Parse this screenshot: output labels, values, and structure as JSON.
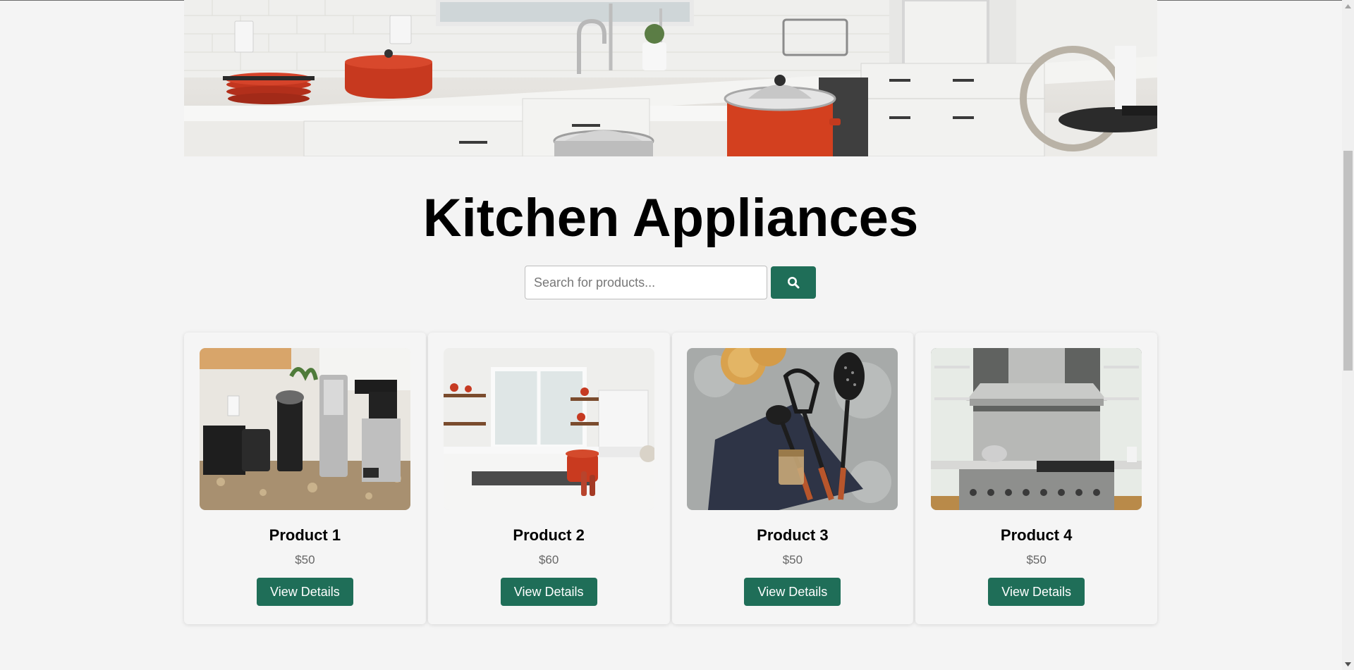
{
  "hero": {
    "image_icon": "kitchen-hero-image"
  },
  "page_title": "Kitchen Appliances",
  "search": {
    "placeholder": "Search for products...",
    "value": "",
    "button_icon": "search-icon"
  },
  "products": [
    {
      "name": "Product 1",
      "price": "$50",
      "button_label": "View Details",
      "image": "coffee-machines-image"
    },
    {
      "name": "Product 2",
      "price": "$60",
      "button_label": "View Details",
      "image": "kitchen-island-image"
    },
    {
      "name": "Product 3",
      "price": "$50",
      "button_label": "View Details",
      "image": "cooking-utensils-image"
    },
    {
      "name": "Product 4",
      "price": "$50",
      "button_label": "View Details",
      "image": "stove-hood-image"
    }
  ],
  "colors": {
    "accent": "#1f6e58",
    "background": "#f4f4f4",
    "price_text": "#666666"
  }
}
